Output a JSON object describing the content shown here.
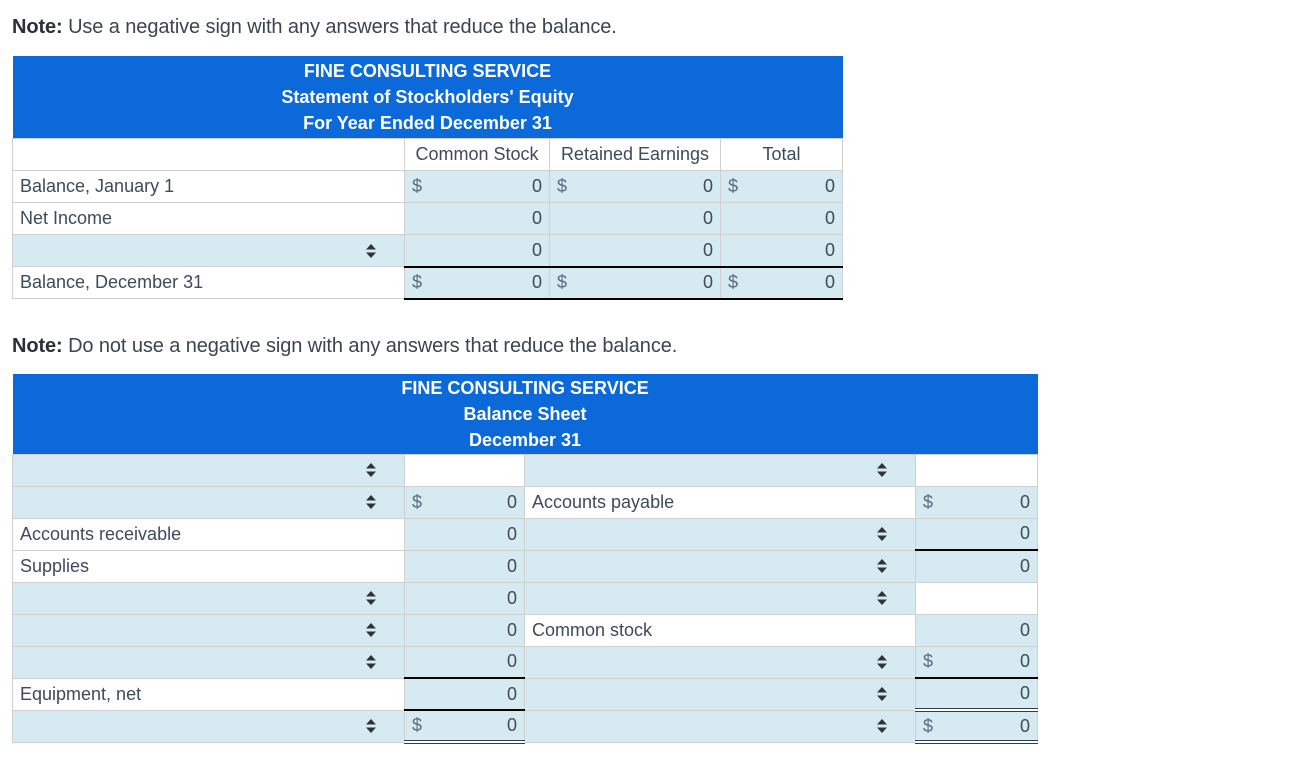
{
  "note1": {
    "bold": "Note:",
    "text": " Use a negative sign with any answers that reduce the balance."
  },
  "note2": {
    "bold": "Note:",
    "text": " Do not use a negative sign with any answers that reduce the balance."
  },
  "equity": {
    "title1": "FINE CONSULTING SERVICE",
    "title2": "Statement of Stockholders' Equity",
    "title3": "For Year Ended December 31",
    "columns": [
      "Common Stock",
      "Retained Earnings",
      "Total"
    ],
    "currency": "$",
    "rows": [
      {
        "label": "Balance, January 1",
        "values": [
          "0",
          "0",
          "0"
        ]
      },
      {
        "label": "Net Income",
        "values": [
          "0",
          "0",
          "0"
        ]
      },
      {
        "label": "",
        "values": [
          "0",
          "0",
          "0"
        ]
      },
      {
        "label": "Balance, December 31",
        "values": [
          "0",
          "0",
          "0"
        ]
      }
    ]
  },
  "balance": {
    "title1": "FINE CONSULTING SERVICE",
    "title2": "Balance Sheet",
    "title3": "December 31",
    "currency": "$",
    "left": [
      {
        "label": "",
        "value": ""
      },
      {
        "label": "",
        "value": "0"
      },
      {
        "label": "Accounts receivable",
        "value": "0"
      },
      {
        "label": "Supplies",
        "value": "0"
      },
      {
        "label": "",
        "value": "0"
      },
      {
        "label": "",
        "value": "0"
      },
      {
        "label": "",
        "value": "0"
      },
      {
        "label": "Equipment, net",
        "value": "0"
      },
      {
        "label": "",
        "value": "0"
      }
    ],
    "right": [
      {
        "label": "",
        "value": ""
      },
      {
        "label": "Accounts payable",
        "value": "0"
      },
      {
        "label": "",
        "value": "0"
      },
      {
        "label": "",
        "value": "0"
      },
      {
        "label": "",
        "value": ""
      },
      {
        "label": "Common stock",
        "value": "0"
      },
      {
        "label": "",
        "value": "0"
      },
      {
        "label": "",
        "value": "0"
      },
      {
        "label": "",
        "value": "0"
      }
    ]
  },
  "icons": {
    "select": "up-down-arrows-icon"
  }
}
